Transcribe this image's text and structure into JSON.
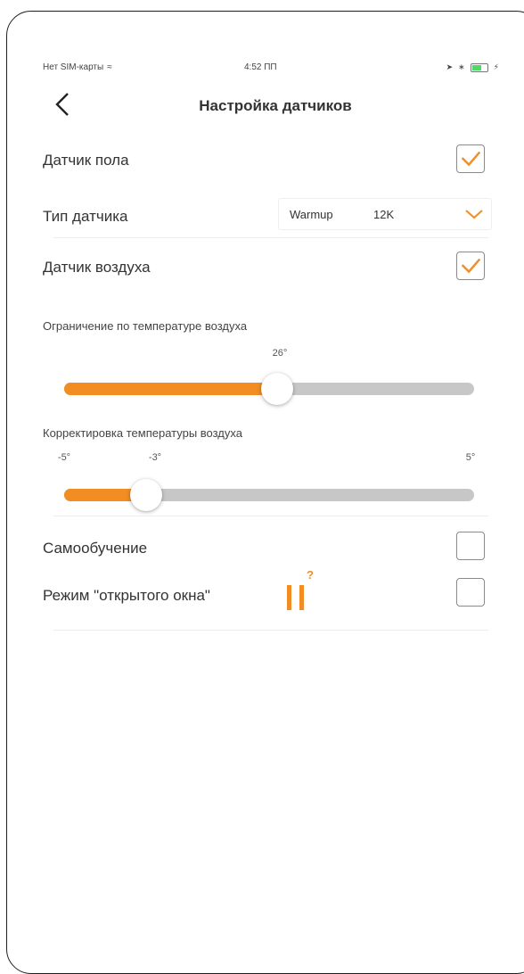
{
  "status_bar": {
    "carrier": "Нет SIM-карты",
    "time": "4:52 ПП",
    "icons": [
      "wifi-icon",
      "location-icon",
      "bluetooth-icon",
      "battery-icon",
      "charging-icon"
    ]
  },
  "nav": {
    "back_icon": "chevron-left-icon",
    "title": "Настройка датчиков"
  },
  "floor_sensor": {
    "label": "Датчик пола",
    "checked": true
  },
  "sensor_type": {
    "label": "Тип датчика",
    "value_name": "Warmup",
    "value_code": "12K",
    "dropdown_icon": "chevron-down-icon"
  },
  "air_sensor": {
    "label": "Датчик воздуха",
    "checked": true
  },
  "air_limit": {
    "label": "Ограничение по температуре воздуха",
    "value_label": "26°",
    "fill_fraction": 0.52
  },
  "air_correction": {
    "label": "Корректировка температуры воздуха",
    "min_label": "-5°",
    "value_label": "-3°",
    "max_label": "5°",
    "value": -3,
    "min": -5,
    "max": 5
  },
  "self_learning": {
    "label": "Самообучение",
    "checked": false
  },
  "open_window": {
    "label": "Режим \"открытого окна\"",
    "checked": false,
    "icon": "pause-icon",
    "help": "?"
  },
  "colors": {
    "accent": "#f18d22",
    "track": "#c7c7c7",
    "border": "#8a8a8a"
  }
}
